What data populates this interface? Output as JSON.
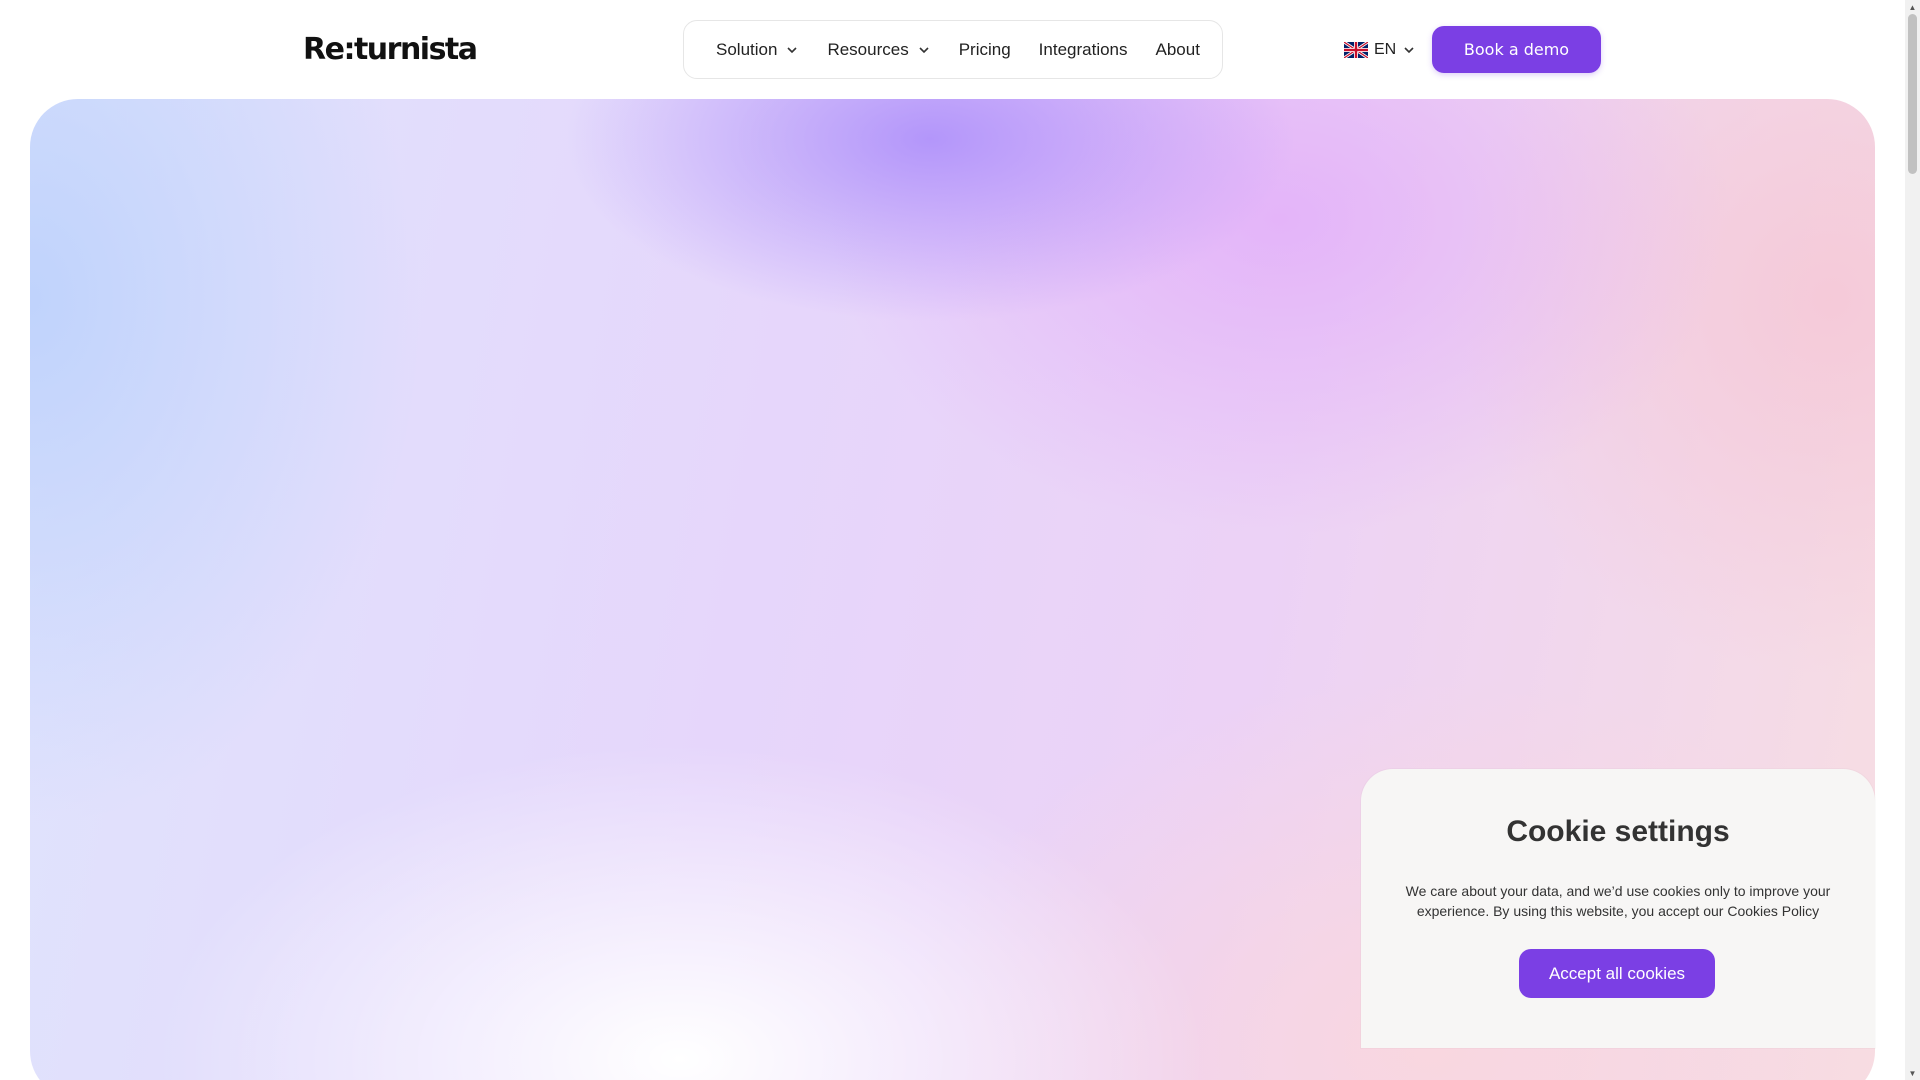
{
  "header": {
    "logo_text": "Re:turnista",
    "nav": {
      "solution": "Solution",
      "resources": "Resources",
      "pricing": "Pricing",
      "integrations": "Integrations",
      "about": "About"
    },
    "language": "EN",
    "language_flag_icon": "uk-flag-icon",
    "demo_button": "Book a demo"
  },
  "cookie_banner": {
    "title": "Cookie settings",
    "text": "We care about your data, and we’d use cookies only to improve your experience. By using this website, you accept our Cookies Policy",
    "accept_button": "Accept all cookies"
  },
  "colors": {
    "accent": "#7b3fe4",
    "card_bg": "#f7f6f5"
  }
}
